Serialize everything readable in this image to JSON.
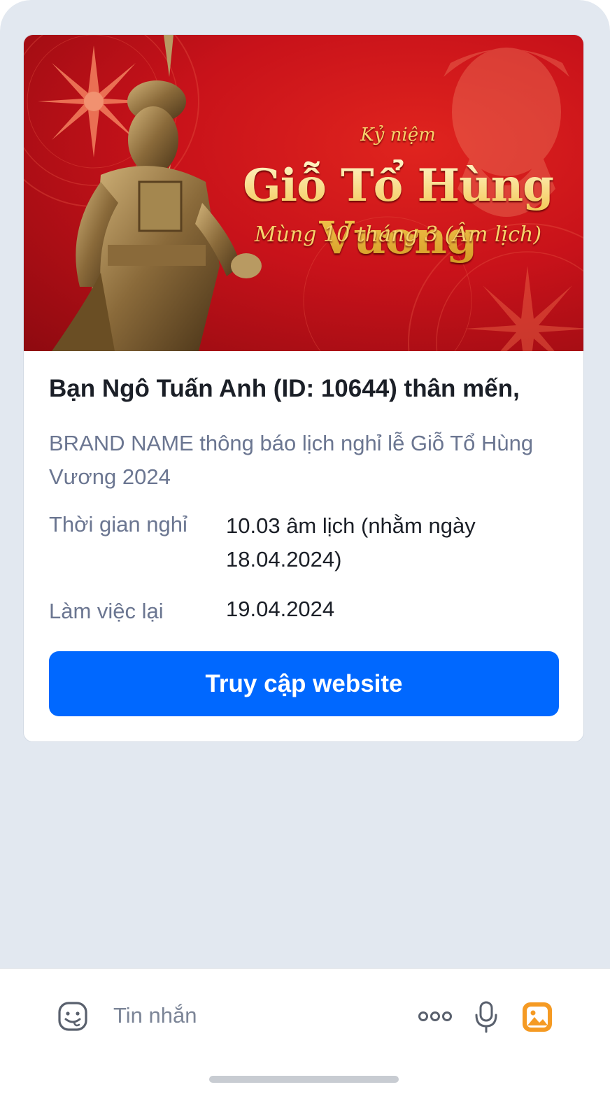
{
  "banner": {
    "subtitle": "Kỷ niệm",
    "title": "Giỗ Tổ Hùng Vương",
    "date": "Mùng 10 tháng 3 (Âm lịch)"
  },
  "message": {
    "greeting": "Bạn Ngô Tuấn Anh (ID: 10644) thân mến,",
    "intro": "BRAND NAME thông báo lịch nghỉ lễ Giỗ Tổ Hùng Vương 2024",
    "rows": [
      {
        "label": "Thời gian nghỉ",
        "value": "10.03 âm lịch (nhằm ngày 18.04.2024)"
      },
      {
        "label": "Làm việc lại",
        "value": "19.04.2024"
      }
    ],
    "cta_label": "Truy cập website"
  },
  "composer": {
    "placeholder": "Tin nhắn",
    "icons": [
      "sticker-icon",
      "more-icon",
      "microphone-icon",
      "image-icon"
    ]
  },
  "colors": {
    "accent": "#0068ff",
    "chat_background": "#e2e8f0",
    "image_icon": "#f59a23"
  }
}
